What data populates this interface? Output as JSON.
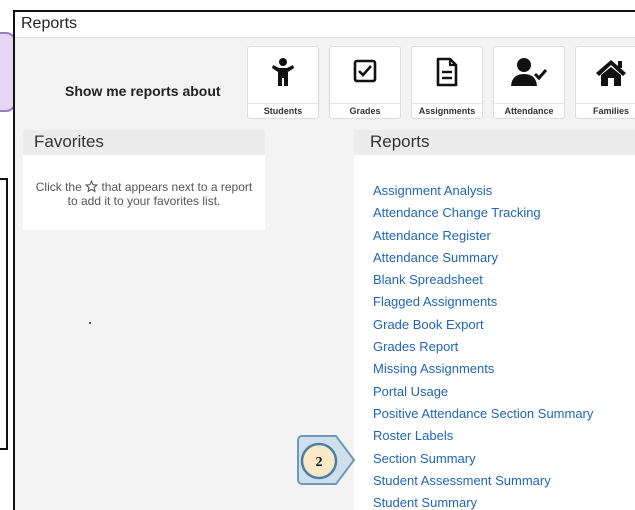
{
  "window": {
    "title": "Reports"
  },
  "category_bar": {
    "prompt": "Show me reports about",
    "tiles": [
      {
        "label": "Students",
        "icon": "child-figure-icon"
      },
      {
        "label": "Grades",
        "icon": "checkbox-icon"
      },
      {
        "label": "Assignments",
        "icon": "document-icon"
      },
      {
        "label": "Attendance",
        "icon": "person-check-icon"
      },
      {
        "label": "Families",
        "icon": "home-icon"
      }
    ]
  },
  "favorites": {
    "title": "Favorites",
    "hint_before": "Click the",
    "hint_after": "that appears next to a report to add it to your favorites list."
  },
  "reports": {
    "title": "Reports",
    "items": [
      "Assignment Analysis",
      "Attendance Change Tracking",
      "Attendance Register",
      "Attendance Summary",
      "Blank Spreadsheet",
      "Flagged Assignments",
      "Grade Book Export",
      "Grades Report",
      "Missing Assignments",
      "Portal Usage",
      "Positive Attendance Section Summary",
      "Roster Labels",
      "Section Summary",
      "Student Assessment Summary",
      "Student Summary"
    ]
  },
  "annotation": {
    "step_number": "2"
  },
  "colors": {
    "link": "#1f66b5",
    "panel_header": "#ececec",
    "background": "#f3f3f3",
    "callout_fill": "#fbe8c6",
    "callout_stroke": "#6e9ab8",
    "purple_callout": "#e5d6f3"
  }
}
